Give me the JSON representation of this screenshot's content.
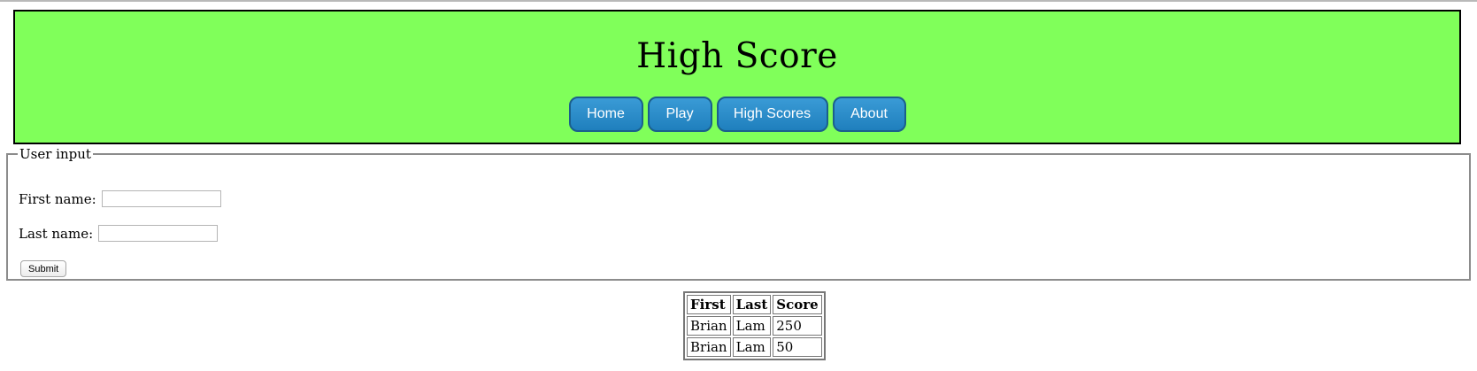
{
  "header": {
    "title": "High Score",
    "nav": [
      {
        "label": "Home"
      },
      {
        "label": "Play"
      },
      {
        "label": "High Scores"
      },
      {
        "label": "About"
      }
    ]
  },
  "form": {
    "legend": "User input",
    "first_name_label": "First name:",
    "first_name_value": "",
    "last_name_label": "Last name:",
    "last_name_value": "",
    "submit_label": "Submit"
  },
  "scores_table": {
    "headers": [
      "First",
      "Last",
      "Score"
    ],
    "rows": [
      [
        "Brian",
        "Lam",
        "250"
      ],
      [
        "Brian",
        "Lam",
        "50"
      ]
    ]
  },
  "colors": {
    "header_bg": "#80ff5a",
    "nav_button": "#2286c8"
  }
}
